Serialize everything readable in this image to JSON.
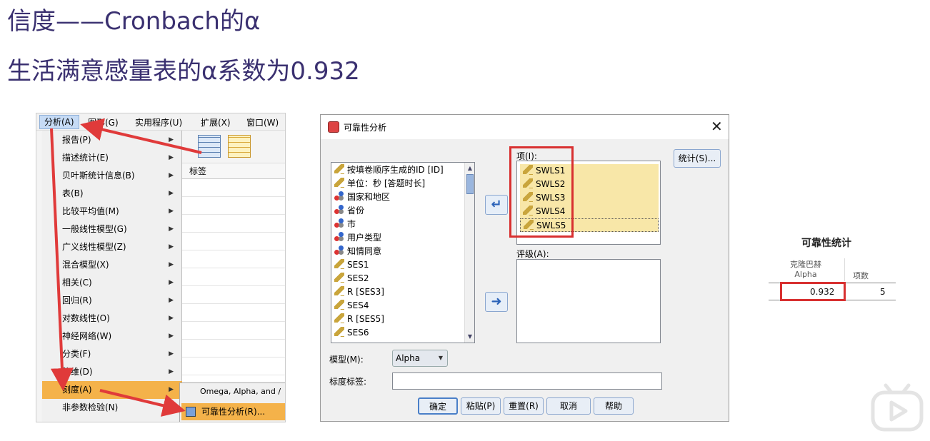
{
  "slide": {
    "title": "信度——Cronbach的α",
    "subtitle": "生活满意感量表的α系数为0.932"
  },
  "menu": {
    "menubar": [
      "分析(A)",
      "图形(G)",
      "实用程序(U)",
      "扩展(X)",
      "窗口(W)"
    ],
    "items": [
      {
        "label": "报告(P)"
      },
      {
        "label": "描述统计(E)"
      },
      {
        "label": "贝叶斯统计信息(B)"
      },
      {
        "label": "表(B)"
      },
      {
        "label": "比较平均值(M)"
      },
      {
        "label": "一般线性模型(G)"
      },
      {
        "label": "广义线性模型(Z)"
      },
      {
        "label": "混合模型(X)"
      },
      {
        "label": "相关(C)"
      },
      {
        "label": "回归(R)"
      },
      {
        "label": "对数线性(O)"
      },
      {
        "label": "神经网络(W)"
      },
      {
        "label": "分类(F)"
      },
      {
        "label": "降维(D)"
      },
      {
        "label": "刻度(A)"
      },
      {
        "label": "非参数检验(N)"
      }
    ],
    "data_column_header": "标签",
    "submenu": {
      "omega": "Omega, Alpha, and /",
      "reliability": "可靠性分析(R)..."
    }
  },
  "dialog": {
    "title": "可靠性分析",
    "variables": [
      {
        "icon": "ruler-icon",
        "label": "按填卷顺序生成的ID [ID]"
      },
      {
        "icon": "ruler-icon",
        "label": "单位：秒 [答题时长]"
      },
      {
        "icon": "nominal-icon",
        "label": "国家和地区"
      },
      {
        "icon": "nominal-icon",
        "label": "省份"
      },
      {
        "icon": "nominal-icon",
        "label": "市"
      },
      {
        "icon": "nominal-icon",
        "label": "用户类型"
      },
      {
        "icon": "nominal-icon",
        "label": "知情同意"
      },
      {
        "icon": "ruler-icon",
        "label": "SES1"
      },
      {
        "icon": "ruler-icon",
        "label": "SES2"
      },
      {
        "icon": "ruler-icon",
        "label": "R [SES3]"
      },
      {
        "icon": "ruler-icon",
        "label": "SES4"
      },
      {
        "icon": "ruler-icon",
        "label": "R [SES5]"
      },
      {
        "icon": "ruler-icon",
        "label": "SES6"
      }
    ],
    "items_label": "项(I):",
    "items": [
      "SWLS1",
      "SWLS2",
      "SWLS3",
      "SWLS4",
      "SWLS5"
    ],
    "ratings_label": "评级(A):",
    "stats_button": "统计(S)...",
    "model_label": "模型(M):",
    "model_value": "Alpha",
    "scale_label": "标度标签:",
    "scale_value": "",
    "buttons": {
      "ok": "确定",
      "paste": "粘贴(P)",
      "reset": "重置(R)",
      "cancel": "取消",
      "help": "帮助"
    }
  },
  "output": {
    "title": "可靠性统计",
    "col1_line1": "克隆巴赫",
    "col1_line2": "Alpha",
    "col2": "项数",
    "alpha_value": "0.932",
    "item_count": "5"
  },
  "colors": {
    "title_color": "#3a3070",
    "highlight_red": "#d83030",
    "menu_active": "#f4b24a",
    "item_fill": "#f8e7a8"
  }
}
